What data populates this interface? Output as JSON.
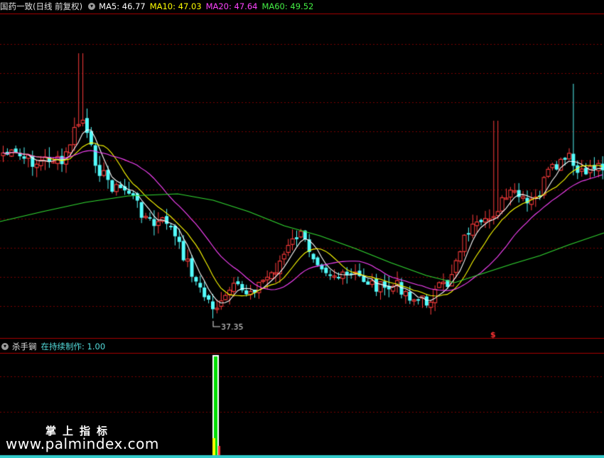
{
  "header": {
    "stock_title": "国药一致(日线 前复权)",
    "indicators": [
      {
        "label": "MA5: 46.77",
        "color": "#ffffff"
      },
      {
        "label": "MA10: 47.03",
        "color": "#ffff00"
      },
      {
        "label": "MA20: 47.64",
        "color": "#ff44ff"
      },
      {
        "label": "MA60: 49.52",
        "color": "#44ee44"
      }
    ]
  },
  "price_panel": {
    "low_annotation": "37.35",
    "marker_glyph": "$"
  },
  "indicator_panel": {
    "name": "杀手锏",
    "status": "在持续制作: 1.00"
  },
  "watermark": {
    "line1": "掌上指标",
    "line2": "www.palmindex.com"
  },
  "colors": {
    "up": "#ff3c3c",
    "down": "#54fcfc",
    "ma5": "#ffffff",
    "ma10": "#ffff00",
    "ma20": "#ff44ff",
    "ma60": "#33dd33",
    "grid": "#7a0000",
    "separator": "#aa0000"
  }
}
